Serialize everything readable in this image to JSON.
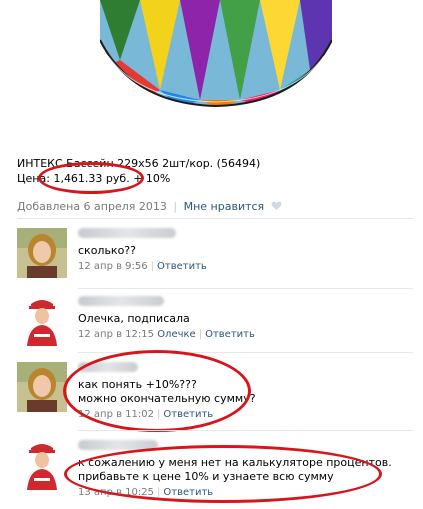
{
  "product": {
    "title": "ИНТЕКС Бассейн 229х56 2шт/кор. (56494)",
    "price": "Цена: 1,461.33 руб. + 10%"
  },
  "meta": {
    "date": "Добавлена 6 апреля 2013",
    "like_label": "Мне нравится"
  },
  "comments": [
    {
      "text": "сколько??",
      "time": "12 апр в 9:56",
      "reply_to": "",
      "reply_label": "Ответить"
    },
    {
      "text": "Олечка, подписала",
      "time": "12 апр в 12:15",
      "reply_to": "Олечке",
      "reply_label": "Ответить"
    },
    {
      "text_line1": "как понять +10%???",
      "text_line2": "можно окончательную сумму?",
      "time": "12 апр в 11:02",
      "reply_label": "Ответить"
    },
    {
      "text_line1": "к сожалению у меня нет на калькуляторе процентов.",
      "text_line2": "прибавьте к цене 10% и узнаете всю сумму",
      "time": "13 апр в 10:25",
      "reply_label": "Ответить"
    }
  ],
  "colors": {
    "link": "#2b587a",
    "muted": "#7a7a7a",
    "annotation": "#d7161c"
  }
}
